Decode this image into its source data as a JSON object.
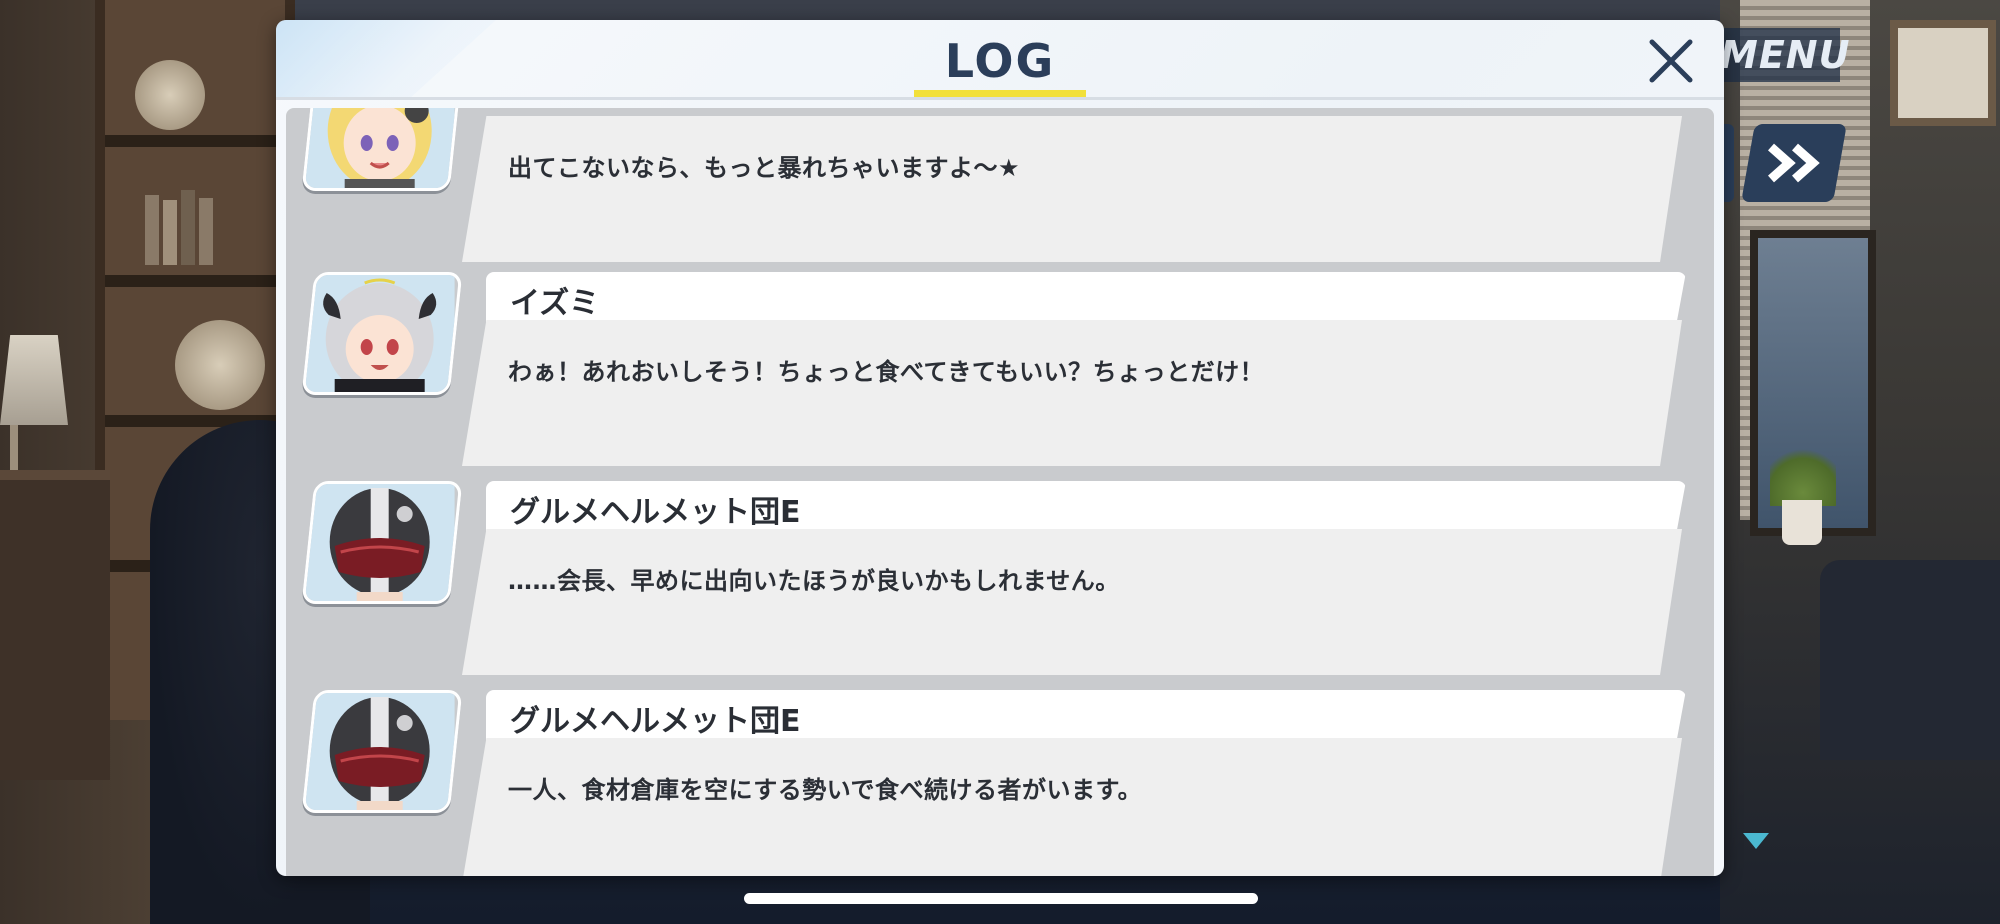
{
  "panel": {
    "title": "LOG",
    "close_icon": "close-icon"
  },
  "hud": {
    "menu_label": "MENU",
    "skip_icon": "fast-forward-icon",
    "scroll_icon": "triangle-down-icon"
  },
  "log_entries": [
    {
      "speaker": "",
      "text": "出てこないなら、もっと暴れちゃいますよ〜★",
      "avatar": "blonde-girl-avatar"
    },
    {
      "speaker": "イズミ",
      "text": "わぁ！あれおいしそう！ちょっと食べてきてもいい？ちょっとだけ！",
      "avatar": "izumi-avatar"
    },
    {
      "speaker": "グルメヘルメット団E",
      "text": "……会長、早めに出向いたほうが良いかもしれません。",
      "avatar": "helmet-avatar"
    },
    {
      "speaker": "グルメヘルメット団E",
      "text": "一人、食材倉庫を空にする勢いで食べ続ける者がいます。",
      "avatar": "helmet-avatar"
    }
  ],
  "colors": {
    "title": "#2b3e5a",
    "title_underline": "#f2e03a",
    "hud_accent": "#2a3e5a",
    "scroll_indicator": "#4bb8d0"
  }
}
